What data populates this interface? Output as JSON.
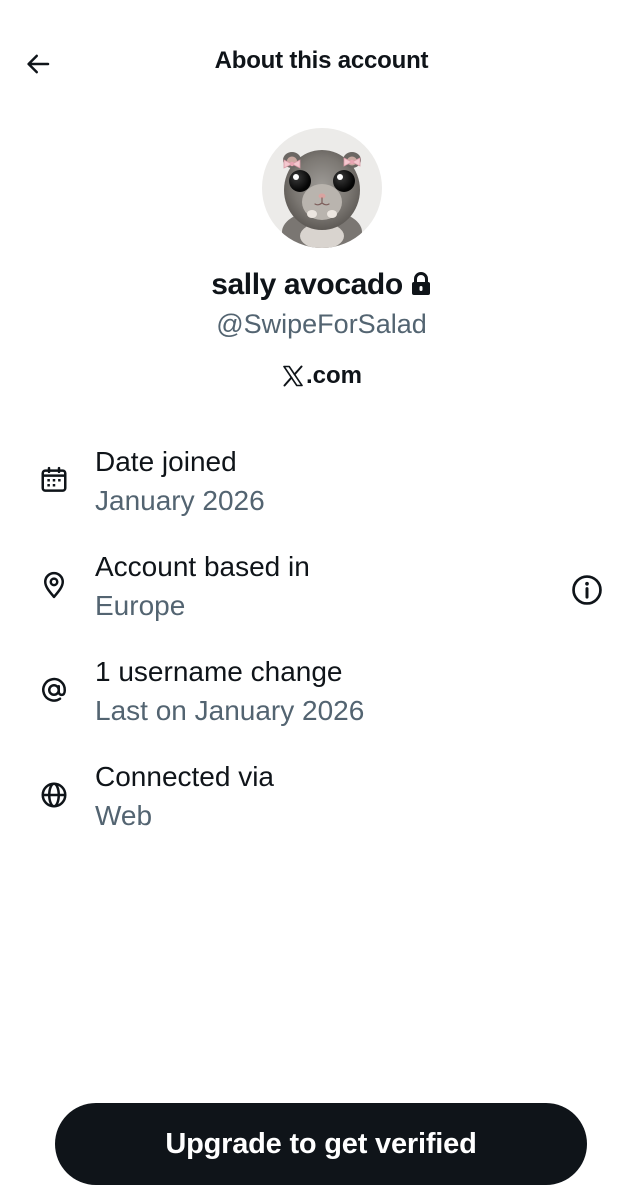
{
  "header": {
    "title": "About this account",
    "back_icon": "arrow-left-icon"
  },
  "profile": {
    "display_name": "sally avocado",
    "protected_icon": "lock-icon",
    "handle": "@SwipeForSalad",
    "site_label": ".com",
    "site_logo": "x-logo-icon",
    "avatar": "hamster-photo"
  },
  "info": [
    {
      "icon": "calendar-icon",
      "label": "Date joined",
      "value": "January 2026"
    },
    {
      "icon": "location-pin-icon",
      "label": "Account based in",
      "value": "Europe",
      "action_icon": "info-circle-icon"
    },
    {
      "icon": "at-sign-icon",
      "label": "1 username change",
      "value": "Last on January 2026"
    },
    {
      "icon": "globe-icon",
      "label": "Connected via",
      "value": "Web"
    }
  ],
  "cta": {
    "label": "Upgrade to get verified"
  },
  "colors": {
    "primary_text": "#0f1419",
    "secondary_text": "#536471",
    "button_bg": "#0f1419",
    "button_text": "#ffffff",
    "background": "#ffffff"
  }
}
